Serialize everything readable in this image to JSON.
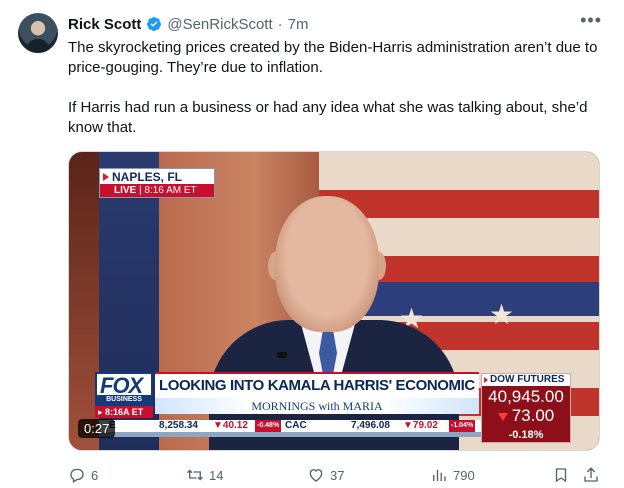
{
  "tweet": {
    "author_name": "Rick Scott",
    "handle": "@SenRickScott",
    "separator": "·",
    "time": "7m",
    "more_icon": "more-icon",
    "paragraph1": "The skyrocketing prices created by the Biden-Harris administration aren’t due to price-gouging. They’re due to inflation.",
    "paragraph2": "If Harris had run a business or had any idea what she was talking about, she’d know that."
  },
  "video": {
    "timer": "0:27",
    "location": "NAPLES, FL",
    "live": "LIVE",
    "live_time": "| 8:16 AM ET",
    "network_top": "FOX",
    "network_sub": "BUSINESS",
    "time_tag": "▸ 8:16A ET",
    "headline": "LOOKING INTO KAMALA HARRIS' ECONOMIC AGENDA",
    "show": "MORNINGS with MARIA",
    "ticker": {
      "t1": "E",
      "t2": "8,258.34",
      "t3": "▼40.12",
      "t4": "-0.48%",
      "t5": "CAC",
      "t6": "7,496.08",
      "t7": "▼79.02",
      "t8": "-1.04%"
    },
    "dow": {
      "title": "DOW FUTURES",
      "value": "40,945.00",
      "change": "73.00",
      "percent": "-0.18%"
    }
  },
  "actions": {
    "replies": "6",
    "reposts": "14",
    "likes": "37",
    "views": "790"
  },
  "colors": {
    "verified": "#1d9bf0",
    "muted": "#536471",
    "fox_red": "#c8102e",
    "fox_navy": "#143a7a"
  }
}
